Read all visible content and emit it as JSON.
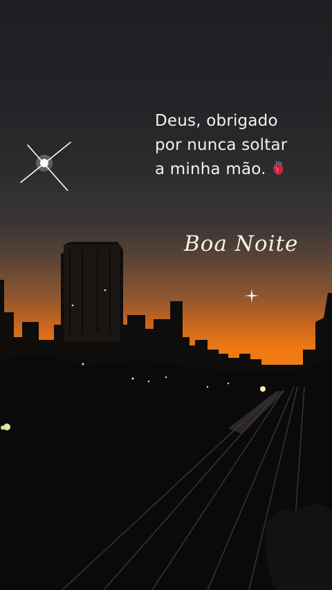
{
  "quote": {
    "line1": "Deus, obrigado",
    "line2": "por nunca soltar",
    "line3": "a minha mão."
  },
  "greeting": "Boa Noite",
  "icons": {
    "heart": "anatomical-heart-icon",
    "sparkle_large": "sparkle-icon",
    "sparkle_small": "sparkle-icon"
  },
  "colors": {
    "sky_top": "#1d1e21",
    "horizon_orange": "#f07c12",
    "text": "#f4f2ef"
  }
}
